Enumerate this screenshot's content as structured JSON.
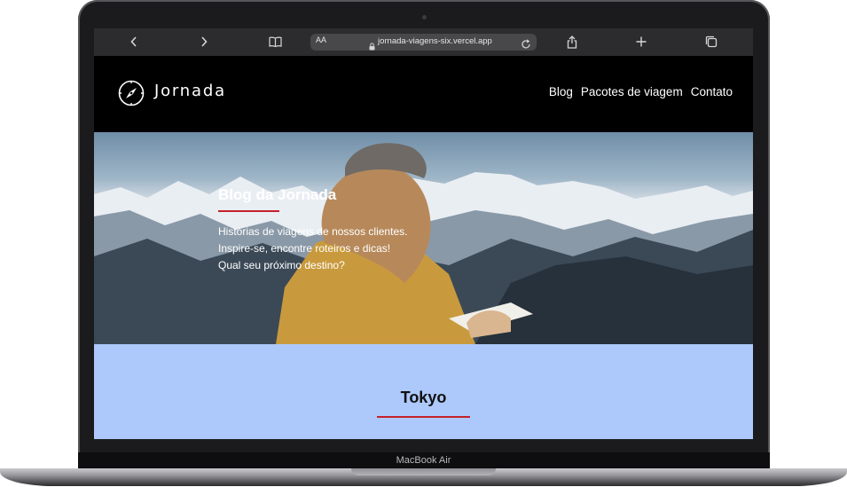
{
  "device": {
    "label": "MacBook Air"
  },
  "browser": {
    "url": "jornada-viagens-six.vercel.app",
    "reader_label": "AA",
    "icons": {
      "back": "chevron-left-icon",
      "forward": "chevron-right-icon",
      "bookmarks": "book-icon",
      "lock": "lock-icon",
      "reload": "reload-icon",
      "share": "share-icon",
      "new_tab": "plus-icon",
      "tabs": "tabs-icon"
    }
  },
  "site": {
    "logo": {
      "text": "Jornada",
      "icon": "compass-icon"
    },
    "nav": [
      {
        "label": "Blog"
      },
      {
        "label": "Pacotes de viagem"
      },
      {
        "label": "Contato"
      }
    ],
    "hero": {
      "title": "Blog da Jornada",
      "text": "Histórias de viagens de nossos clientes. Inspire-se, encontre roteiros e dicas! Qual seu próximo destino?"
    },
    "section": {
      "title": "Tokyo"
    }
  },
  "colors": {
    "accent": "#c4202b",
    "header_bg": "#000000",
    "section_bg": "#adc9fb"
  }
}
